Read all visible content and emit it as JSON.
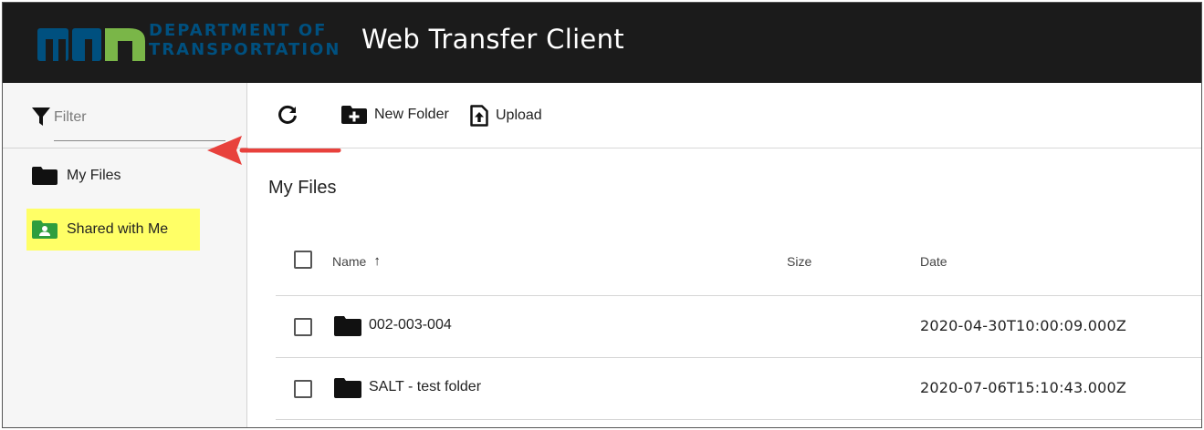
{
  "header": {
    "logo_text": "mn",
    "dept_line1": "DEPARTMENT OF",
    "dept_line2": "TRANSPORTATION",
    "app_title": "Web Transfer Client"
  },
  "sidebar": {
    "filter_placeholder": "Filter",
    "items": [
      {
        "label": "My Files",
        "icon": "folder-icon"
      },
      {
        "label": "Shared with Me",
        "icon": "shared-folder-icon",
        "highlighted": true
      }
    ]
  },
  "toolbar": {
    "refresh_icon": "refresh-icon",
    "new_folder_label": "New Folder",
    "upload_label": "Upload"
  },
  "main": {
    "title": "My Files",
    "columns": {
      "name": "Name",
      "size": "Size",
      "date": "Date",
      "sort_indicator": "↑"
    },
    "rows": [
      {
        "name": "002-003-004",
        "size": "",
        "date": "2020-04-30T10:00:09.000Z"
      },
      {
        "name": "SALT - test folder",
        "size": "",
        "date": "2020-07-06T15:10:43.000Z"
      }
    ]
  },
  "colors": {
    "header_bg": "#1b1b1b",
    "logo_blue": "#00507f",
    "highlight": "#ffff66",
    "annotation_arrow": "#e8413c",
    "shared_icon_green": "#2e9e3e"
  }
}
